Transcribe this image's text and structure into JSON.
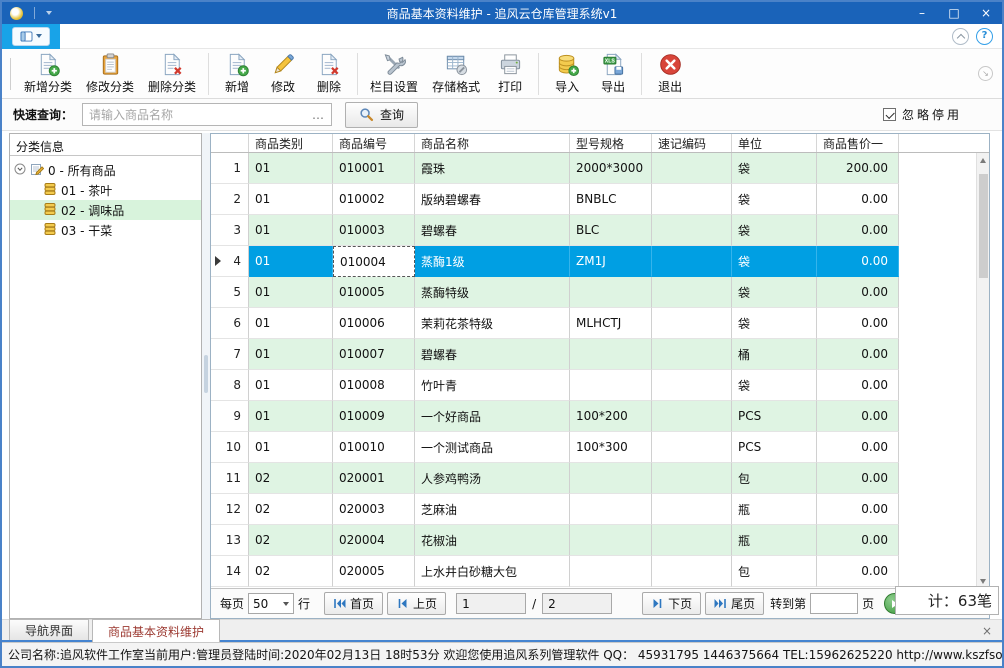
{
  "window": {
    "title": "商品基本资料维护 - 追风云仓库管理系统v1",
    "controls": {
      "minimize": "–",
      "maximize": "□",
      "close": "×"
    }
  },
  "colors": {
    "titlebar": "#1a63b9",
    "ribbon_accent": "#18a3e8",
    "row_green": "#dff4e3",
    "selected_row": "#009fe3",
    "tab_active_text": "#9c3a32",
    "tree_selected": "#d8f3dc"
  },
  "toolbar": {
    "buttons": [
      {
        "name": "add-category",
        "label": "新增分类",
        "icon": "doc-add",
        "group": 1
      },
      {
        "name": "edit-category",
        "label": "修改分类",
        "icon": "clipboard",
        "group": 1
      },
      {
        "name": "delete-category",
        "label": "删除分类",
        "icon": "doc-delete",
        "group": 1
      },
      {
        "name": "add",
        "label": "新增",
        "icon": "doc-add",
        "group": 2
      },
      {
        "name": "edit",
        "label": "修改",
        "icon": "pencil",
        "group": 2
      },
      {
        "name": "delete",
        "label": "删除",
        "icon": "doc-delete",
        "group": 2
      },
      {
        "name": "column-settings",
        "label": "栏目设置",
        "icon": "tools",
        "group": 3
      },
      {
        "name": "storage-format",
        "label": "存储格式",
        "icon": "table-config",
        "group": 3
      },
      {
        "name": "print",
        "label": "打印",
        "icon": "printer",
        "group": 3
      },
      {
        "name": "import",
        "label": "导入",
        "icon": "db-import",
        "group": 4
      },
      {
        "name": "export",
        "label": "导出",
        "icon": "xls-export",
        "group": 4
      },
      {
        "name": "exit",
        "label": "退出",
        "icon": "exit",
        "group": 5
      }
    ]
  },
  "search": {
    "label": "快速查询：",
    "placeholder": "请输入商品名称",
    "ellipsis": "…",
    "query_label": "查询",
    "ignore_disabled_label": "忽略停用",
    "ignore_disabled_checked": true
  },
  "tree": {
    "header": "分类信息",
    "items": [
      {
        "label": "0 - 所有商品",
        "level": 0,
        "selected": false,
        "icon": "category-root-icon"
      },
      {
        "label": "01 - 茶叶",
        "level": 1,
        "selected": false,
        "icon": "category-icon"
      },
      {
        "label": "02 - 调味品",
        "level": 1,
        "selected": true,
        "icon": "category-icon"
      },
      {
        "label": "03 - 干菜",
        "level": 1,
        "selected": false,
        "icon": "category-icon"
      }
    ]
  },
  "table": {
    "columns": [
      "商品类别",
      "商品编号",
      "商品名称",
      "型号规格",
      "速记编码",
      "单位",
      "商品售价一"
    ],
    "rows": [
      {
        "num": 1,
        "selected": false,
        "cells": [
          "01",
          "010001",
          "霞珠",
          "2000*3000",
          "",
          "袋",
          "200.00"
        ]
      },
      {
        "num": 2,
        "selected": false,
        "cells": [
          "01",
          "010002",
          "版纳碧螺春",
          "BNBLC",
          "",
          "袋",
          "0.00"
        ]
      },
      {
        "num": 3,
        "selected": false,
        "cells": [
          "01",
          "010003",
          "碧螺春",
          "BLC",
          "",
          "袋",
          "0.00"
        ]
      },
      {
        "num": 4,
        "selected": true,
        "cells": [
          "01",
          "010004",
          "蒸酶1级",
          "ZM1J",
          "",
          "袋",
          "0.00"
        ]
      },
      {
        "num": 5,
        "selected": false,
        "cells": [
          "01",
          "010005",
          "蒸酶特级",
          "",
          "",
          "袋",
          "0.00"
        ]
      },
      {
        "num": 6,
        "selected": false,
        "cells": [
          "01",
          "010006",
          "茉莉花茶特级",
          "MLHCTJ",
          "",
          "袋",
          "0.00"
        ]
      },
      {
        "num": 7,
        "selected": false,
        "cells": [
          "01",
          "010007",
          "碧螺春",
          "",
          "",
          "桶",
          "0.00"
        ]
      },
      {
        "num": 8,
        "selected": false,
        "cells": [
          "01",
          "010008",
          "竹叶青",
          "",
          "",
          "袋",
          "0.00"
        ]
      },
      {
        "num": 9,
        "selected": false,
        "cells": [
          "01",
          "010009",
          "一个好商品",
          "100*200",
          "",
          "PCS",
          "0.00"
        ]
      },
      {
        "num": 10,
        "selected": false,
        "cells": [
          "01",
          "010010",
          "一个测试商品",
          "100*300",
          "",
          "PCS",
          "0.00"
        ]
      },
      {
        "num": 11,
        "selected": false,
        "cells": [
          "02",
          "020001",
          "人参鸡鸭汤",
          "",
          "",
          "包",
          "0.00"
        ]
      },
      {
        "num": 12,
        "selected": false,
        "cells": [
          "02",
          "020003",
          "芝麻油",
          "",
          "",
          "瓶",
          "0.00"
        ]
      },
      {
        "num": 13,
        "selected": false,
        "cells": [
          "02",
          "020004",
          "花椒油",
          "",
          "",
          "瓶",
          "0.00"
        ]
      },
      {
        "num": 14,
        "selected": false,
        "cells": [
          "02",
          "020005",
          "上水井白砂糖大包",
          "",
          "",
          "包",
          "0.00"
        ]
      }
    ]
  },
  "pager": {
    "per_page_label": "每页",
    "per_page_value": "50",
    "rows_label": "行",
    "first_label": "首页",
    "prev_label": "上页",
    "current_page": "1",
    "slash": "/",
    "total_pages": "2",
    "next_label": "下页",
    "last_label": "尾页",
    "goto_label": "转到第",
    "goto_value": "",
    "page_unit_label": "页",
    "total_count": "计：63笔"
  },
  "tabs": [
    {
      "label": "导航界面",
      "active": false
    },
    {
      "label": "商品基本资料维护",
      "active": true
    }
  ],
  "tab_strip": {
    "close": "×"
  },
  "statusbar": {
    "text": "公司名称:追风软件工作室当前用户:管理员登陆时间:2020年02月13日 18时53分 欢迎您使用追风系列管理软件 QQ： 45931795 1446375664 TEL:15962625220 http://www.kszfsoft.com.cn"
  }
}
